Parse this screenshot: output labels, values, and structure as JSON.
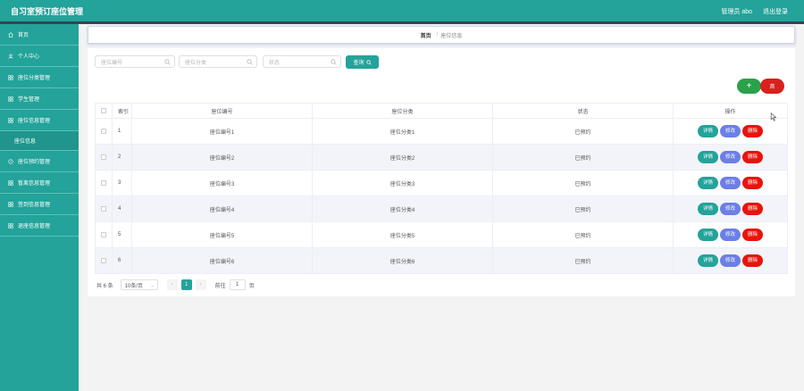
{
  "header": {
    "title": "自习室预订座位管理",
    "user": "管理员 abo",
    "logout": "退出登录"
  },
  "sidebar": {
    "items": [
      {
        "label": "首页",
        "icon": "home-icon"
      },
      {
        "label": "个人中心",
        "icon": "user-icon"
      },
      {
        "label": "座位分类管理",
        "icon": "grid-icon"
      },
      {
        "label": "学生管理",
        "icon": "grid-icon"
      },
      {
        "label": "座位信息管理",
        "icon": "grid-icon"
      },
      {
        "label": "座位信息",
        "sub": true
      },
      {
        "label": "座位预约管理",
        "icon": "clock-icon"
      },
      {
        "label": "暂离信息管理",
        "icon": "grid-icon"
      },
      {
        "label": "签到信息管理",
        "icon": "grid-icon"
      },
      {
        "label": "退座信息管理",
        "icon": "grid-icon"
      }
    ]
  },
  "breadcrumb": {
    "home": "首页",
    "sep": "/",
    "current": "座位信息"
  },
  "search": {
    "seat_no_placeholder": "座位编号",
    "category_placeholder": "座位分类",
    "status_placeholder": "状态",
    "query_label": "查询"
  },
  "actions": {
    "add_label": "+",
    "delete_label": "首"
  },
  "table": {
    "headers": [
      "索引",
      "座位编号",
      "座位分类",
      "状态",
      "操作"
    ],
    "rows": [
      {
        "index": "1",
        "seat_no": "座位编号1",
        "category": "座位分类1",
        "status": "已预约"
      },
      {
        "index": "2",
        "seat_no": "座位编号2",
        "category": "座位分类2",
        "status": "已预约"
      },
      {
        "index": "3",
        "seat_no": "座位编号3",
        "category": "座位分类3",
        "status": "已预约"
      },
      {
        "index": "4",
        "seat_no": "座位编号4",
        "category": "座位分类4",
        "status": "已预约"
      },
      {
        "index": "5",
        "seat_no": "座位编号5",
        "category": "座位分类5",
        "status": "已预约"
      },
      {
        "index": "6",
        "seat_no": "座位编号6",
        "category": "座位分类6",
        "status": "已预约"
      }
    ],
    "ops": {
      "detail": "详情",
      "edit": "修改",
      "delete": "删除"
    }
  },
  "pagination": {
    "total": "共 6 条",
    "page_size": "10条/页",
    "prev": "‹",
    "current": "1",
    "next": "›",
    "goto_prefix": "前往",
    "goto_value": "1",
    "goto_suffix": "页"
  },
  "colors": {
    "primary": "#23a39a",
    "add": "#2aa24a",
    "danger": "#d8201c",
    "edit": "#6c7fe6"
  }
}
